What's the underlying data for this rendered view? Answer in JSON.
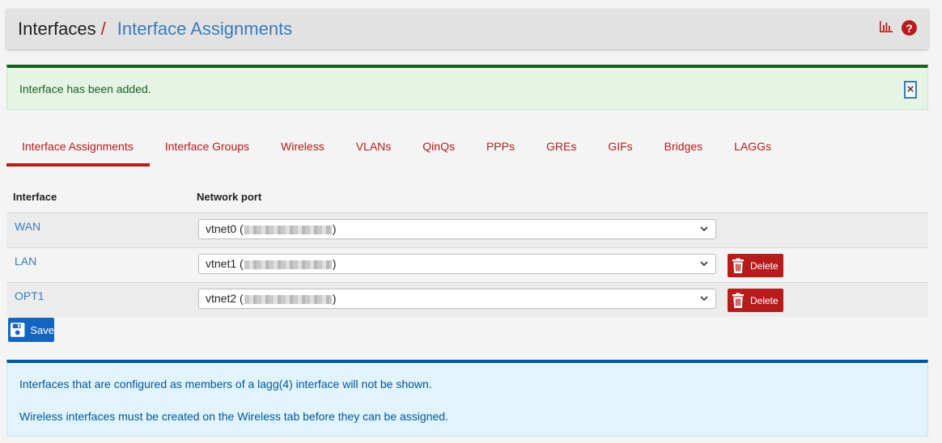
{
  "breadcrumb": {
    "root": "Interfaces",
    "separator": "/",
    "current": "Interface Assignments"
  },
  "header_icons": {
    "chart": "bar-chart-icon",
    "help": "help-icon",
    "help_glyph": "?"
  },
  "alert": {
    "message": "Interface has been added.",
    "close_glyph": "×"
  },
  "tabs": [
    {
      "label": "Interface Assignments",
      "active": true
    },
    {
      "label": "Interface Groups"
    },
    {
      "label": "Wireless"
    },
    {
      "label": "VLANs"
    },
    {
      "label": "QinQs"
    },
    {
      "label": "PPPs"
    },
    {
      "label": "GREs"
    },
    {
      "label": "GIFs"
    },
    {
      "label": "Bridges"
    },
    {
      "label": "LAGGs"
    }
  ],
  "table": {
    "headers": {
      "interface": "Interface",
      "port": "Network port"
    },
    "rows": [
      {
        "name": "WAN",
        "port": "vtnet0 (",
        "port_end": ")",
        "deletable": false
      },
      {
        "name": "LAN",
        "port": "vtnet1 (",
        "port_end": ")",
        "deletable": true,
        "delete_label": "Delete"
      },
      {
        "name": "OPT1",
        "port": "vtnet2 (",
        "port_end": ")",
        "deletable": true,
        "delete_label": "Delete"
      }
    ]
  },
  "save_label": "Save",
  "info": {
    "line1": "Interfaces that are configured as members of a lagg(4) interface will not be shown.",
    "line2": "Wireless interfaces must be created on the Wireless tab before they can be assigned."
  },
  "colors": {
    "accent_red": "#b71c1c",
    "link_blue": "#3a7bbf",
    "save_blue": "#1565c0",
    "success_green": "#1b5e20",
    "info_blue": "#01579b"
  }
}
